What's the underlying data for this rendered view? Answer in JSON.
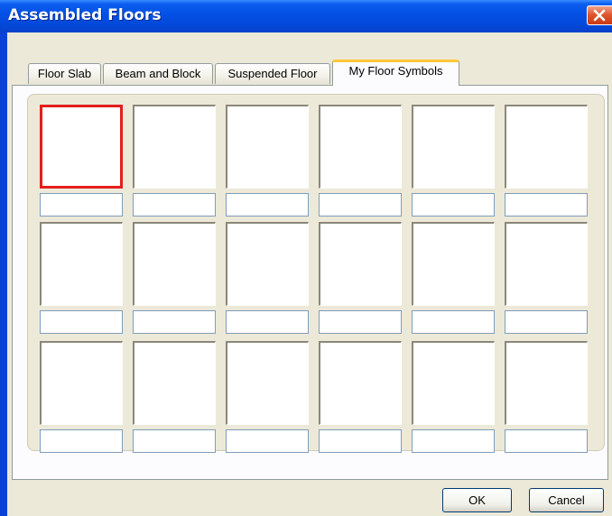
{
  "window": {
    "title": "Assembled Floors",
    "colors": {
      "titlebar": "#0551e6",
      "close": "#e0572f",
      "face": "#ece9d8",
      "selected_border": "#e41e1e",
      "tab_accent": "#ffc83c"
    },
    "close_icon": "close-icon"
  },
  "tabs": [
    {
      "label": "Floor Slab",
      "active": false
    },
    {
      "label": "Beam and Block",
      "active": false
    },
    {
      "label": "Suspended Floor",
      "active": false
    },
    {
      "label": "My Floor Symbols",
      "active": true
    }
  ],
  "grid": {
    "rows": 3,
    "columns": 6,
    "selected_cell": 1,
    "cells": [
      {
        "name": ""
      },
      {
        "name": ""
      },
      {
        "name": ""
      },
      {
        "name": ""
      },
      {
        "name": ""
      },
      {
        "name": ""
      },
      {
        "name": ""
      },
      {
        "name": ""
      },
      {
        "name": ""
      },
      {
        "name": ""
      },
      {
        "name": ""
      },
      {
        "name": ""
      },
      {
        "name": ""
      },
      {
        "name": ""
      },
      {
        "name": ""
      },
      {
        "name": ""
      },
      {
        "name": ""
      },
      {
        "name": ""
      }
    ]
  },
  "buttons": {
    "ok": "OK",
    "cancel": "Cancel"
  }
}
